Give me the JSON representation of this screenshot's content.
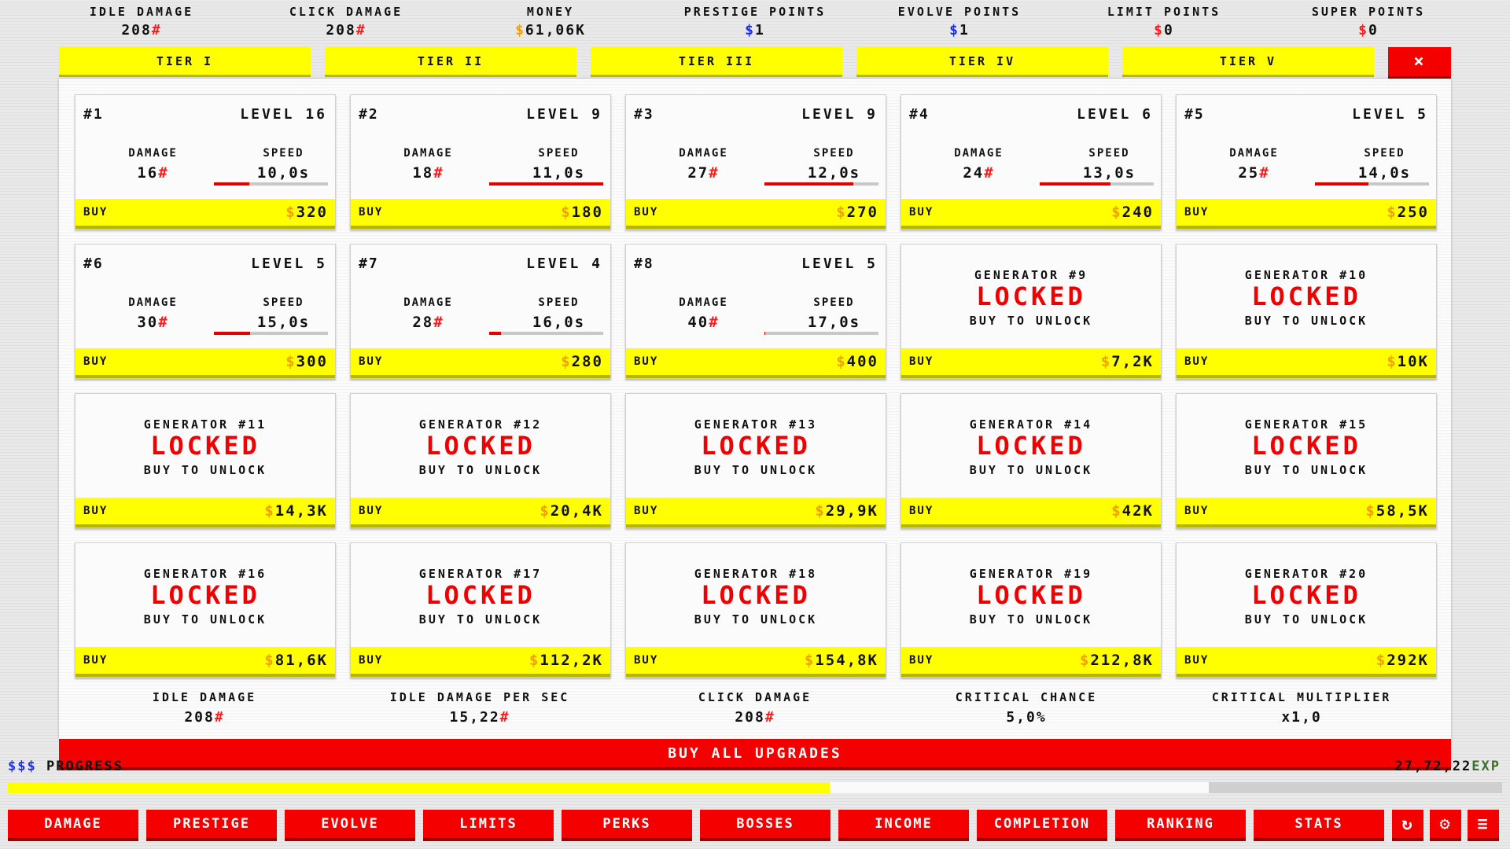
{
  "top_stats": [
    {
      "label": "IDLE DAMAGE",
      "prefix": "",
      "value": "208",
      "suffix": "#"
    },
    {
      "label": "CLICK DAMAGE",
      "prefix": "",
      "value": "208",
      "suffix": "#"
    },
    {
      "label": "MONEY",
      "prefix": "$",
      "value": "61,06K",
      "suffix": ""
    },
    {
      "label": "PRESTIGE POINTS",
      "prefix": "$",
      "value": "1",
      "suffix": ""
    },
    {
      "label": "EVOLVE POINTS",
      "prefix": "$",
      "value": "1",
      "suffix": ""
    },
    {
      "label": "LIMIT POINTS",
      "prefix": "$",
      "value": "0",
      "suffix": ""
    },
    {
      "label": "SUPER POINTS",
      "prefix": "$",
      "value": "0",
      "suffix": ""
    }
  ],
  "tiers": [
    "TIER I",
    "TIER II",
    "TIER III",
    "TIER IV",
    "TIER V"
  ],
  "close_label": "×",
  "generators_unlocked": [
    {
      "num": "#1",
      "level": "LEVEL 16",
      "damage": "16",
      "speed": "10,0s",
      "speed_progress": 0.31,
      "price": "320"
    },
    {
      "num": "#2",
      "level": "LEVEL 9",
      "damage": "18",
      "speed": "11,0s",
      "speed_progress": 1.0,
      "price": "180"
    },
    {
      "num": "#3",
      "level": "LEVEL 9",
      "damage": "27",
      "speed": "12,0s",
      "speed_progress": 0.78,
      "price": "270"
    },
    {
      "num": "#4",
      "level": "LEVEL 6",
      "damage": "24",
      "speed": "13,0s",
      "speed_progress": 0.62,
      "price": "240"
    },
    {
      "num": "#5",
      "level": "LEVEL 5",
      "damage": "25",
      "speed": "14,0s",
      "speed_progress": 0.47,
      "price": "250"
    },
    {
      "num": "#6",
      "level": "LEVEL 5",
      "damage": "30",
      "speed": "15,0s",
      "speed_progress": 0.32,
      "price": "300"
    },
    {
      "num": "#7",
      "level": "LEVEL 4",
      "damage": "28",
      "speed": "16,0s",
      "speed_progress": 0.1,
      "price": "280"
    },
    {
      "num": "#8",
      "level": "LEVEL 5",
      "damage": "40",
      "speed": "17,0s",
      "speed_progress": 0.01,
      "price": "400"
    }
  ],
  "generators_locked": [
    {
      "title": "GENERATOR #9",
      "price": "7,2K"
    },
    {
      "title": "GENERATOR #10",
      "price": "10K"
    },
    {
      "title": "GENERATOR #11",
      "price": "14,3K"
    },
    {
      "title": "GENERATOR #12",
      "price": "20,4K"
    },
    {
      "title": "GENERATOR #13",
      "price": "29,9K"
    },
    {
      "title": "GENERATOR #14",
      "price": "42K"
    },
    {
      "title": "GENERATOR #15",
      "price": "58,5K"
    },
    {
      "title": "GENERATOR #16",
      "price": "81,6K"
    },
    {
      "title": "GENERATOR #17",
      "price": "112,2K"
    },
    {
      "title": "GENERATOR #18",
      "price": "154,8K"
    },
    {
      "title": "GENERATOR #19",
      "price": "212,8K"
    },
    {
      "title": "GENERATOR #20",
      "price": "292K"
    }
  ],
  "card_labels": {
    "damage": "DAMAGE",
    "speed": "SPEED",
    "buy": "BUY",
    "locked": "LOCKED",
    "unlock_hint": "BUY TO UNLOCK",
    "currency": "$",
    "hash": "#"
  },
  "bottom_stats": [
    {
      "label": "IDLE DAMAGE",
      "value": "208",
      "suffix": "#"
    },
    {
      "label": "IDLE DAMAGE PER SEC",
      "value": "15,22",
      "suffix": "#"
    },
    {
      "label": "CLICK DAMAGE",
      "value": "208",
      "suffix": "#"
    },
    {
      "label": "CRITICAL CHANCE",
      "value": "5,0%",
      "suffix": ""
    },
    {
      "label": "CRITICAL MULTIPLIER",
      "value": "x1,0",
      "suffix": ""
    }
  ],
  "buy_all_label": "BUY ALL UPGRADES",
  "hud": {
    "progress_prefix": "$$$",
    "progress_label": "PROGRESS",
    "progress_fill": 0.55,
    "exp_value": "27,72,22",
    "exp_label": "EXP"
  },
  "nav": [
    "DAMAGE",
    "PRESTIGE",
    "EVOLVE",
    "LIMITS",
    "PERKS",
    "BOSSES",
    "INCOME",
    "COMPLETION",
    "RANKING",
    "STATS"
  ],
  "nav_icons": [
    "refresh-icon",
    "gear-icon",
    "menu-icon"
  ],
  "colors": {
    "accent_red": "#f40000",
    "accent_yellow": "#ffff00",
    "currency_gold": "#f0a000",
    "currency_blue": "#1a2bff",
    "hash_red": "#ff1a1a"
  }
}
